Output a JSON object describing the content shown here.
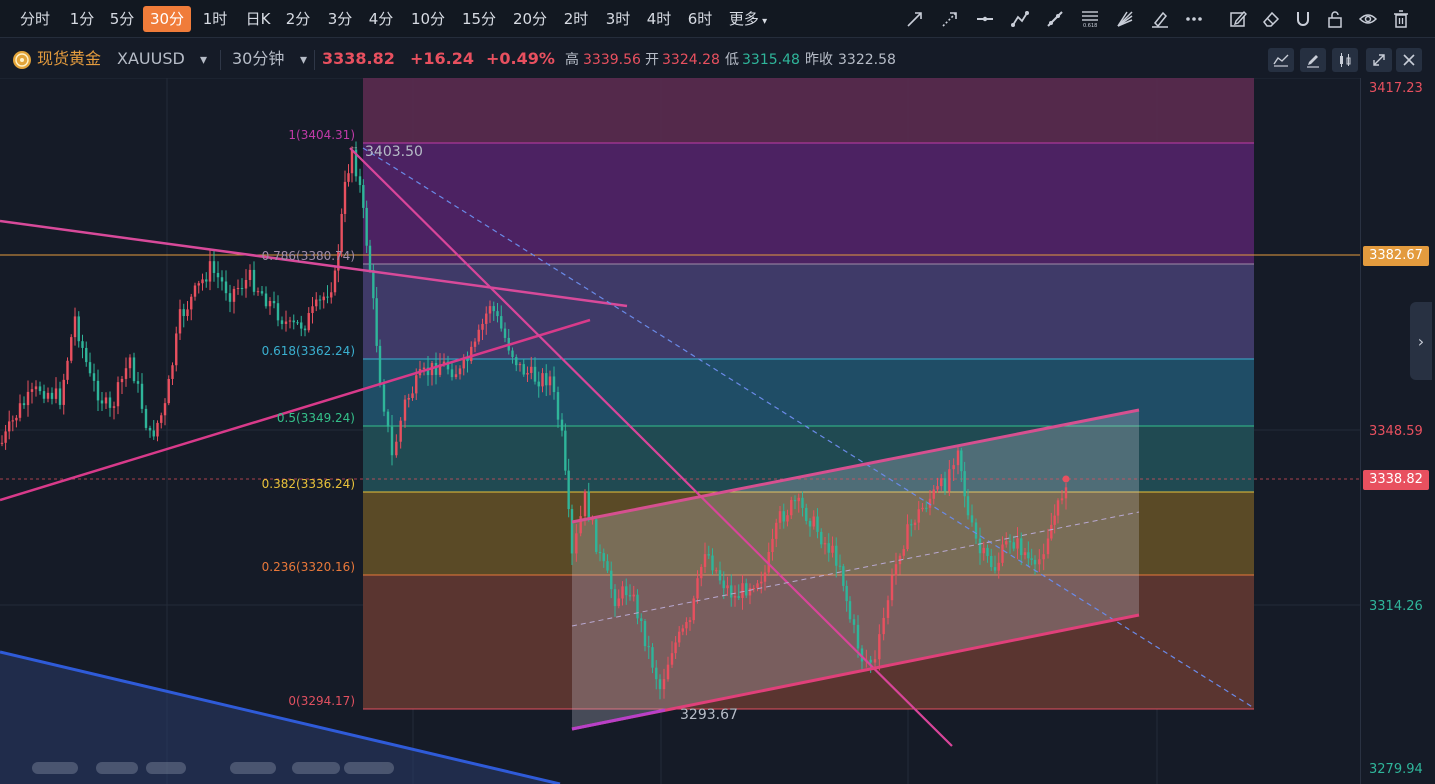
{
  "toolbar": {
    "timeframes": [
      "分时",
      "1分",
      "5分",
      "30分",
      "1时",
      "日K",
      "2分",
      "3分",
      "4分",
      "10分",
      "15分",
      "20分",
      "2时",
      "3时",
      "4时",
      "6时"
    ],
    "active_timeframe": "30分",
    "more_label": "更多",
    "drawing_tools": [
      "arrow-line-icon",
      "dashed-arrow-icon",
      "horizontal-line-icon",
      "polyline-icon",
      "ray-icon",
      "fibonacci-retracement-icon",
      "fan-icon",
      "brush-icon",
      "more-dots-icon"
    ],
    "right_tools": [
      "edit-icon",
      "eraser-icon",
      "magnet-icon",
      "unlock-icon",
      "eye-icon",
      "trash-icon"
    ]
  },
  "symbol": {
    "name": "现货黄金",
    "code": "XAUUSD",
    "period": "30分钟",
    "price": "3338.82",
    "change": "+16.24",
    "change_pct": "+0.49%",
    "high_label": "高",
    "high": "3339.56",
    "open_label": "开",
    "open": "3324.28",
    "low_label": "低",
    "low": "3315.48",
    "prev_close_label": "昨收",
    "prev_close": "3322.58"
  },
  "price_axis": {
    "labels": [
      "3417.23",
      "3348.59",
      "3314.26",
      "3279.94"
    ],
    "marker_orange": "3382.67",
    "marker_current": "3338.82"
  },
  "fibonacci": {
    "levels": [
      {
        "label": "1(3404.31)",
        "color": "#c03aa8"
      },
      {
        "label": "0.786(3380.74)",
        "color": "#a08ca8"
      },
      {
        "label": "0.618(3362.24)",
        "color": "#3ab0d0"
      },
      {
        "label": "0.5(3349.24)",
        "color": "#34c08a"
      },
      {
        "label": "0.382(3336.24)",
        "color": "#e8c23a"
      },
      {
        "label": "0.236(3320.16)",
        "color": "#e8783a"
      },
      {
        "label": "0(3294.17)",
        "color": "#e05060"
      }
    ]
  },
  "annotations": {
    "peak": "3403.50",
    "trough": "3293.67"
  },
  "colors": {
    "up": "#e8505f",
    "down": "#2fb59a",
    "accent": "#f07c3a",
    "gold_line": "#e39b3e"
  }
}
